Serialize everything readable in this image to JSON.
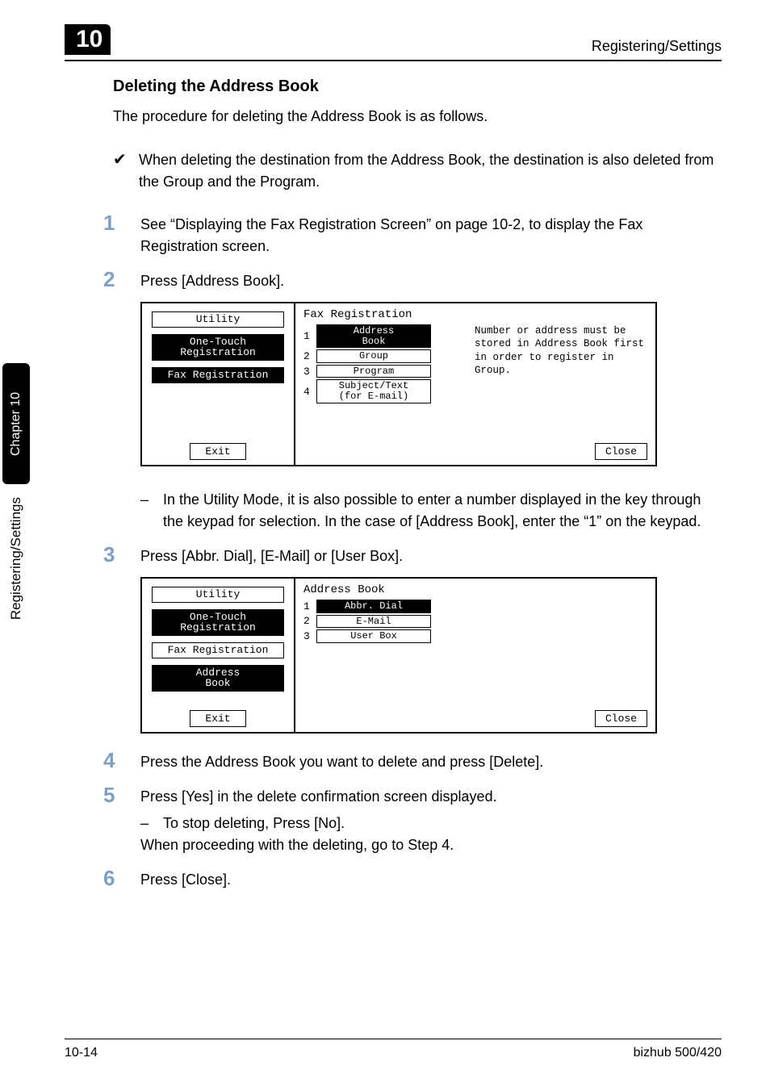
{
  "chapter_number": "10",
  "running_head": "Registering/Settings",
  "section_heading": "Deleting the Address Book",
  "intro": "The procedure for deleting the Address Book is as follows.",
  "precondition": "When deleting the destination from the Address Book, the destination is also deleted from the Group and the Program.",
  "steps": {
    "s1": "See “Displaying the Fax Registration Screen” on page 10-2, to display the Fax Registration screen.",
    "s2": "Press [Address Book].",
    "s2_note": "In the Utility Mode, it is also possible to enter a number displayed in the key through the keypad for selection. In the case of [Address Book], enter the “1” on the keypad.",
    "s3": "Press [Abbr. Dial], [E-Mail] or [User Box].",
    "s4": "Press the Address Book you want to delete and press [Delete].",
    "s5": "Press [Yes] in the delete confirmation screen displayed.",
    "s5_note": "To stop deleting, Press [No].",
    "s5_tail": "When proceeding with the deleting, go to Step 4.",
    "s6": "Press [Close]."
  },
  "step_numbers": {
    "n1": "1",
    "n2": "2",
    "n3": "3",
    "n4": "4",
    "n5": "5",
    "n6": "6"
  },
  "lcd1": {
    "title": "Fax Registration",
    "left": {
      "utility": "Utility",
      "onetouch": "One-Touch\nRegistration",
      "faxreg": "Fax Registration",
      "exit": "Exit"
    },
    "items": {
      "n1": "1",
      "l1": "Address\nBook",
      "n2": "2",
      "l2": "Group",
      "n3": "3",
      "l3": "Program",
      "n4": "4",
      "l4": "Subject/Text\n(for E-mail)"
    },
    "msg": "Number or address must be stored in Address Book first in order to register in Group.",
    "close": "Close"
  },
  "lcd2": {
    "title": "Address Book",
    "left": {
      "utility": "Utility",
      "onetouch": "One-Touch\nRegistration",
      "faxreg": "Fax Registration",
      "addr": "Address\nBook",
      "exit": "Exit"
    },
    "items": {
      "n1": "1",
      "l1": "Abbr. Dial",
      "n2": "2",
      "l2": "E-Mail",
      "n3": "3",
      "l3": "User Box"
    },
    "close": "Close"
  },
  "side_tab": {
    "black": "Chapter 10",
    "label": "Registering/Settings"
  },
  "footer": {
    "left": "10-14",
    "right": "bizhub 500/420"
  }
}
